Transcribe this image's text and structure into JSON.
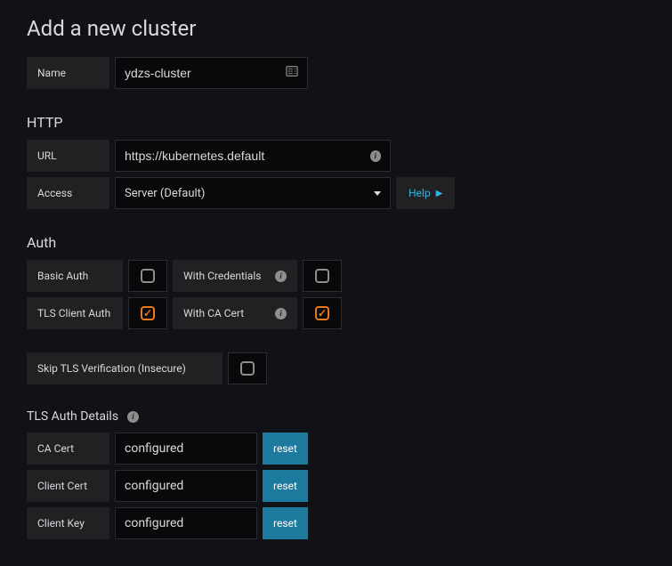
{
  "page_title": "Add a new cluster",
  "name": {
    "label": "Name",
    "value": "ydzs-cluster"
  },
  "http": {
    "section_title": "HTTP",
    "url": {
      "label": "URL",
      "value": "https://kubernetes.default"
    },
    "access": {
      "label": "Access",
      "value": "Server (Default)"
    },
    "help_label": "Help"
  },
  "auth": {
    "section_title": "Auth",
    "basic_auth": {
      "label": "Basic Auth",
      "checked": false
    },
    "with_credentials": {
      "label": "With Credentials",
      "checked": false
    },
    "tls_client_auth": {
      "label": "TLS Client Auth",
      "checked": true
    },
    "with_ca_cert": {
      "label": "With CA Cert",
      "checked": true
    },
    "skip_tls": {
      "label": "Skip TLS Verification (Insecure)",
      "checked": false
    }
  },
  "tls_details": {
    "section_title": "TLS Auth Details",
    "ca_cert": {
      "label": "CA Cert",
      "value": "configured",
      "reset": "reset"
    },
    "client_cert": {
      "label": "Client Cert",
      "value": "configured",
      "reset": "reset"
    },
    "client_key": {
      "label": "Client Key",
      "value": "configured",
      "reset": "reset"
    }
  }
}
